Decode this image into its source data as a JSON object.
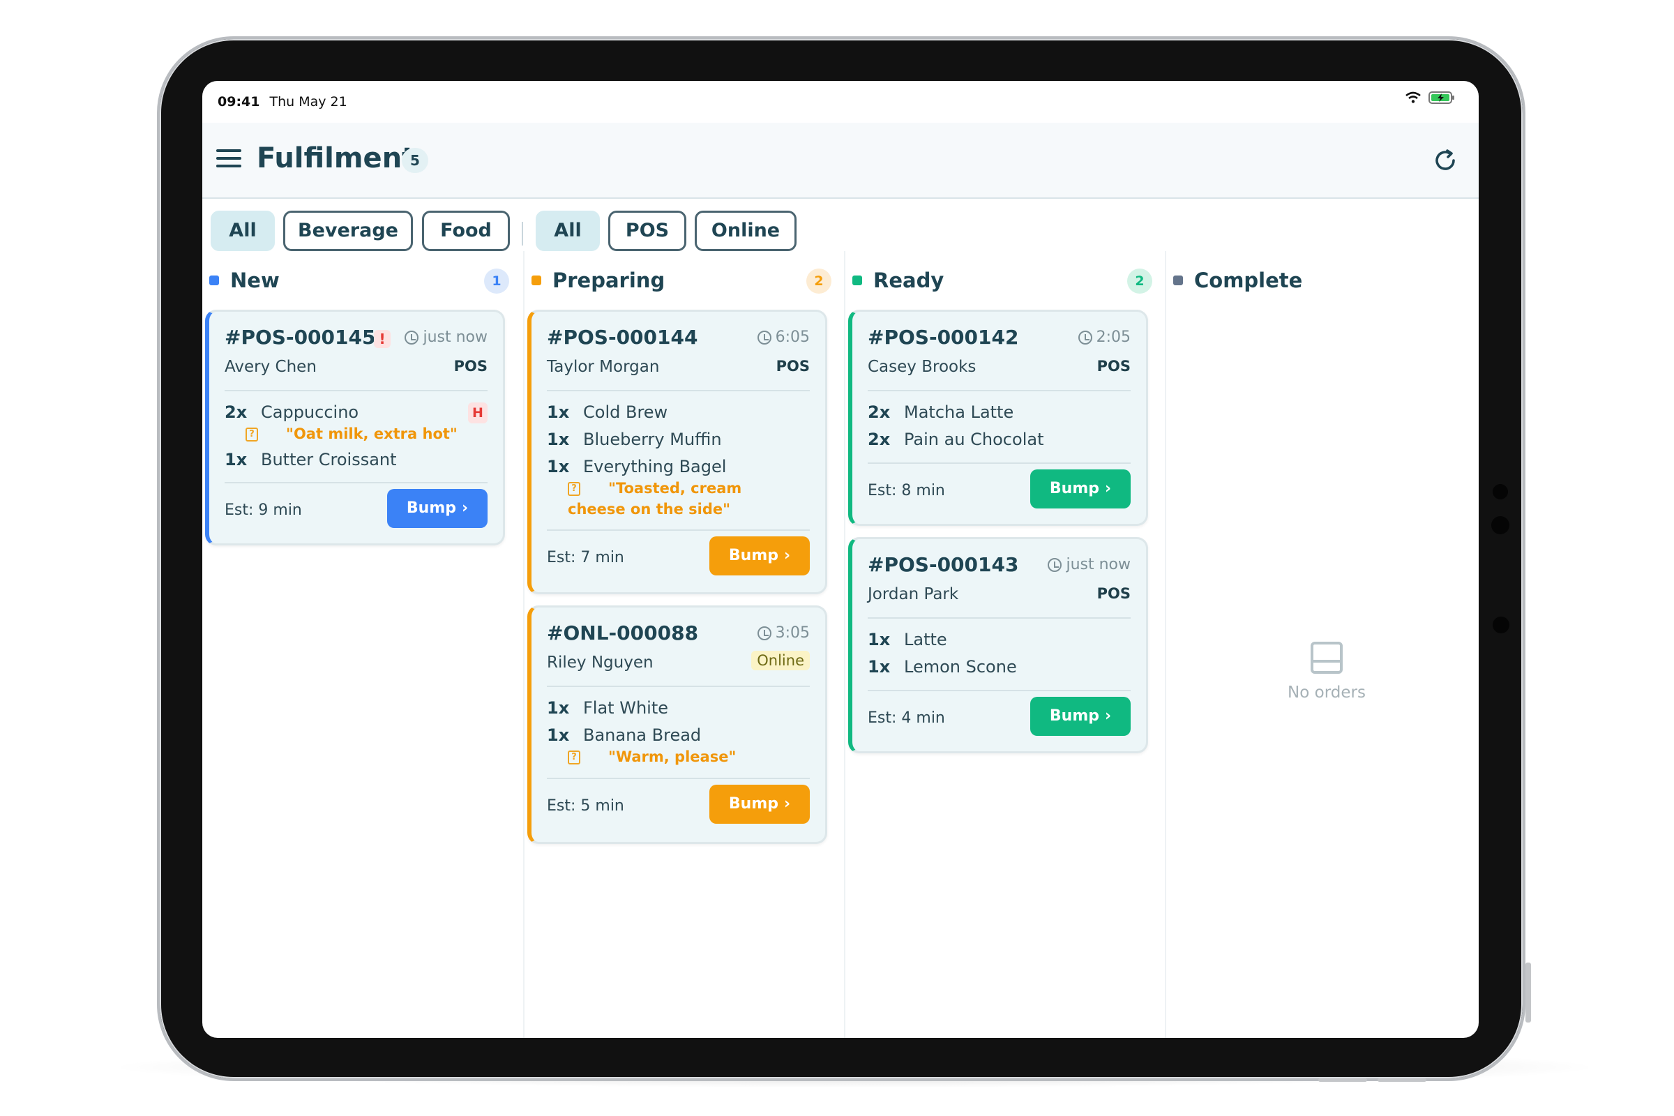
{
  "status_bar": {
    "time": "09:41",
    "date": "Thu May 21"
  },
  "header": {
    "title": "Fulfilment",
    "count": "5"
  },
  "filters": {
    "category": [
      "All",
      "Beverage",
      "Food"
    ],
    "channel": [
      "All",
      "POS",
      "Online"
    ]
  },
  "colors": {
    "new": "#3b82f6",
    "preparing": "#f59e0b",
    "ready": "#10b981",
    "complete": "#64748b"
  },
  "columns": {
    "new": {
      "title": "New",
      "count": "1"
    },
    "preparing": {
      "title": "Preparing",
      "count": "2"
    },
    "ready": {
      "title": "Ready",
      "count": "2"
    },
    "complete": {
      "title": "Complete",
      "empty": "No orders"
    }
  },
  "orders": {
    "pos145": {
      "id": "#POS-000145",
      "urgent": "!",
      "time": "just now",
      "customer": "Avery Chen",
      "source": "POS",
      "items": [
        {
          "qty": "2x",
          "name": "Cappuccino",
          "flag": "H",
          "note": "\"Oat milk, extra hot\""
        },
        {
          "qty": "1x",
          "name": "Butter Croissant"
        }
      ],
      "est": "Est: 9 min",
      "bump": "Bump"
    },
    "pos144": {
      "id": "#POS-000144",
      "time": "6:05",
      "customer": "Taylor Morgan",
      "source": "POS",
      "items": [
        {
          "qty": "1x",
          "name": "Cold Brew"
        },
        {
          "qty": "1x",
          "name": "Blueberry Muffin"
        },
        {
          "qty": "1x",
          "name": "Everything Bagel",
          "note": "\"Toasted, cream cheese on the side\""
        }
      ],
      "est": "Est: 7 min",
      "bump": "Bump"
    },
    "onl088": {
      "id": "#ONL-000088",
      "time": "3:05",
      "customer": "Riley Nguyen",
      "source": "Online",
      "items": [
        {
          "qty": "1x",
          "name": "Flat White"
        },
        {
          "qty": "1x",
          "name": "Banana Bread",
          "note": "\"Warm, please\""
        }
      ],
      "est": "Est: 5 min",
      "bump": "Bump"
    },
    "pos142": {
      "id": "#POS-000142",
      "time": "2:05",
      "customer": "Casey Brooks",
      "source": "POS",
      "items": [
        {
          "qty": "2x",
          "name": "Matcha Latte"
        },
        {
          "qty": "2x",
          "name": "Pain au Chocolat"
        }
      ],
      "est": "Est: 8 min",
      "bump": "Bump"
    },
    "pos143": {
      "id": "#POS-000143",
      "time": "just now",
      "customer": "Jordan Park",
      "source": "POS",
      "items": [
        {
          "qty": "1x",
          "name": "Latte"
        },
        {
          "qty": "1x",
          "name": "Lemon Scone"
        }
      ],
      "est": "Est: 4 min",
      "bump": "Bump"
    }
  }
}
